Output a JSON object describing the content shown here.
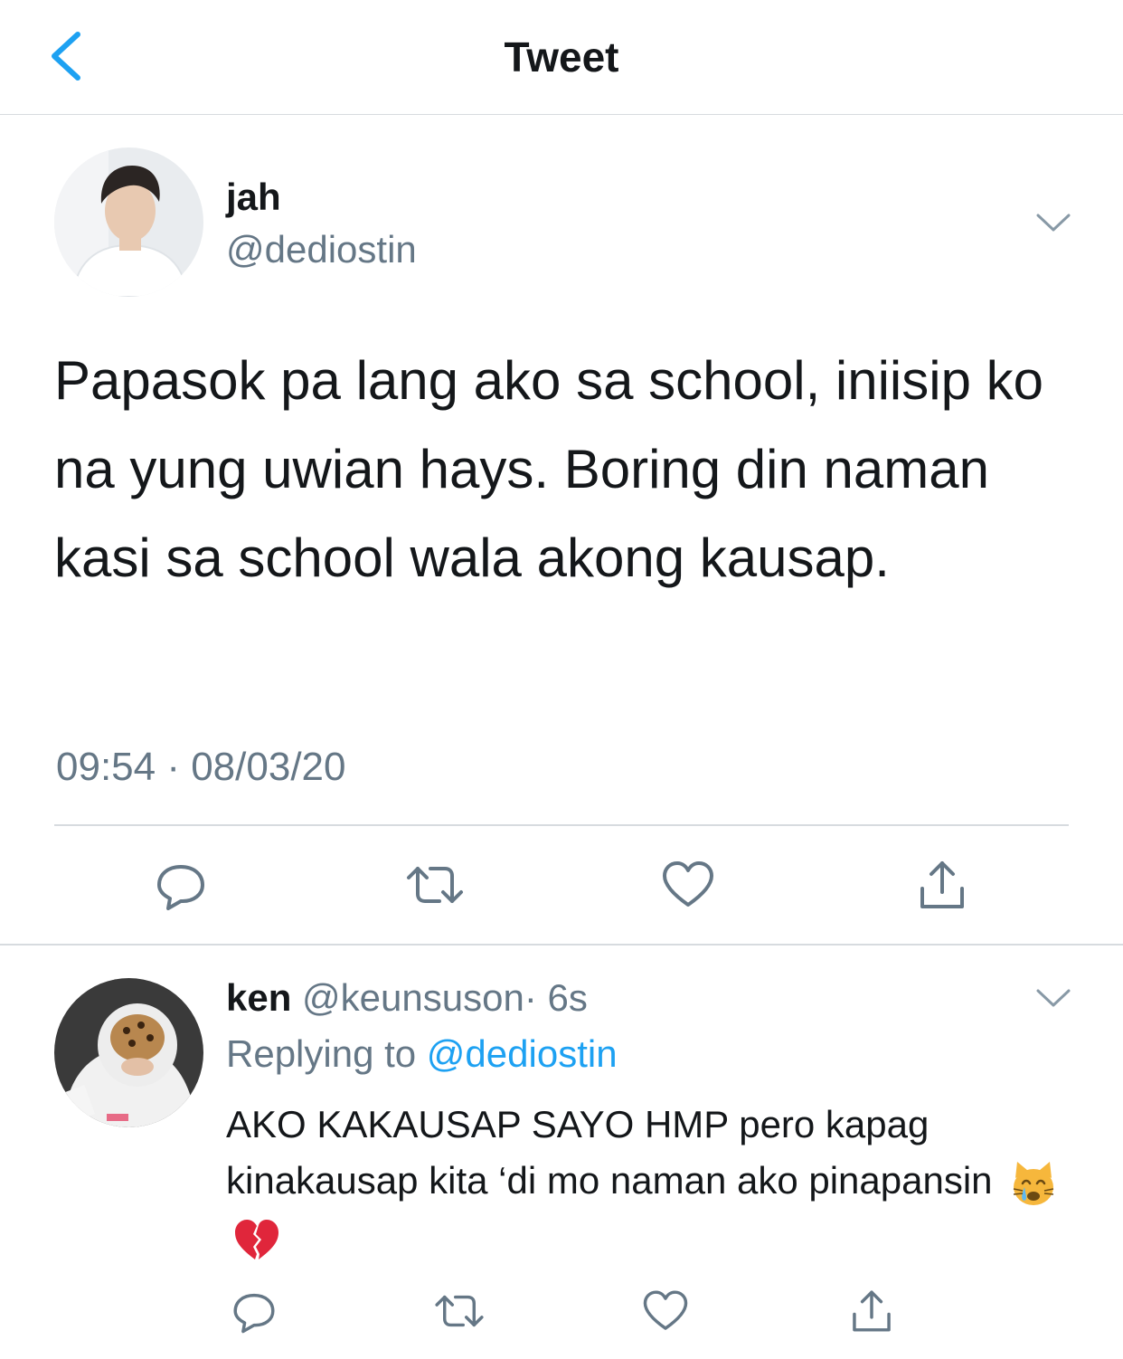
{
  "nav": {
    "title": "Tweet",
    "back_icon": "chevron-left-icon"
  },
  "colors": {
    "accent": "#1da1f2",
    "secondary_text": "#657786",
    "primary_text": "#14171a",
    "divider": "#d7dbdf"
  },
  "tweet": {
    "name": "jah",
    "handle": "@dediostin",
    "text": "Papasok pa lang ako sa school, iniisip ko na yung uwian hays. Boring din naman kasi sa school wala akong kausap.",
    "timestamp": "09:54 · 08/03/20",
    "actions": [
      "reply-icon",
      "retweet-icon",
      "like-icon",
      "share-icon"
    ]
  },
  "reply": {
    "name": "ken",
    "handle": "@keunsuson",
    "time": "· 6s",
    "replying_prefix": "Replying to",
    "replying_to": "@dediostin",
    "text": "AKO KAKAUSAP SAYO HMP pero kapag kinakausap kita ‘di mo naman ako pinapansin",
    "emojis": [
      "crying-cat-emoji",
      "broken-heart-emoji"
    ],
    "actions": [
      "reply-icon",
      "retweet-icon",
      "like-icon",
      "share-icon"
    ]
  }
}
